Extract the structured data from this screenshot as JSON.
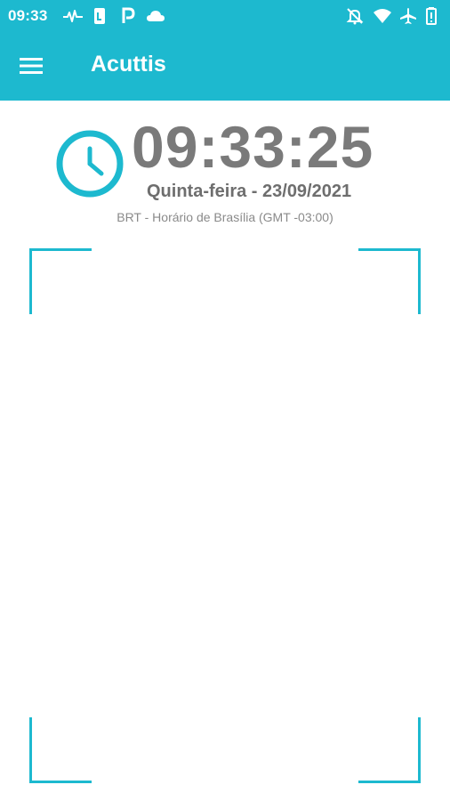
{
  "status_bar": {
    "time": "09:33",
    "icons": [
      "pulse-icon",
      "phone-card-icon",
      "parking-icon",
      "cloud-icon",
      "bell-off-icon",
      "wifi-icon",
      "airplane-icon",
      "battery-icon"
    ]
  },
  "app_bar": {
    "title": "Acuttis",
    "menu_icon": "menu-icon"
  },
  "clock": {
    "time": "09:33:25",
    "date": "Quinta-feira - 23/09/2021",
    "timezone": "BRT - Horário de Brasília (GMT -03:00)"
  },
  "colors": {
    "primary": "#1db9cf",
    "time_text": "#7a7a7a",
    "date_text": "#6e6e6e",
    "tz_text": "#8a8a8a",
    "background": "#ffffff"
  }
}
